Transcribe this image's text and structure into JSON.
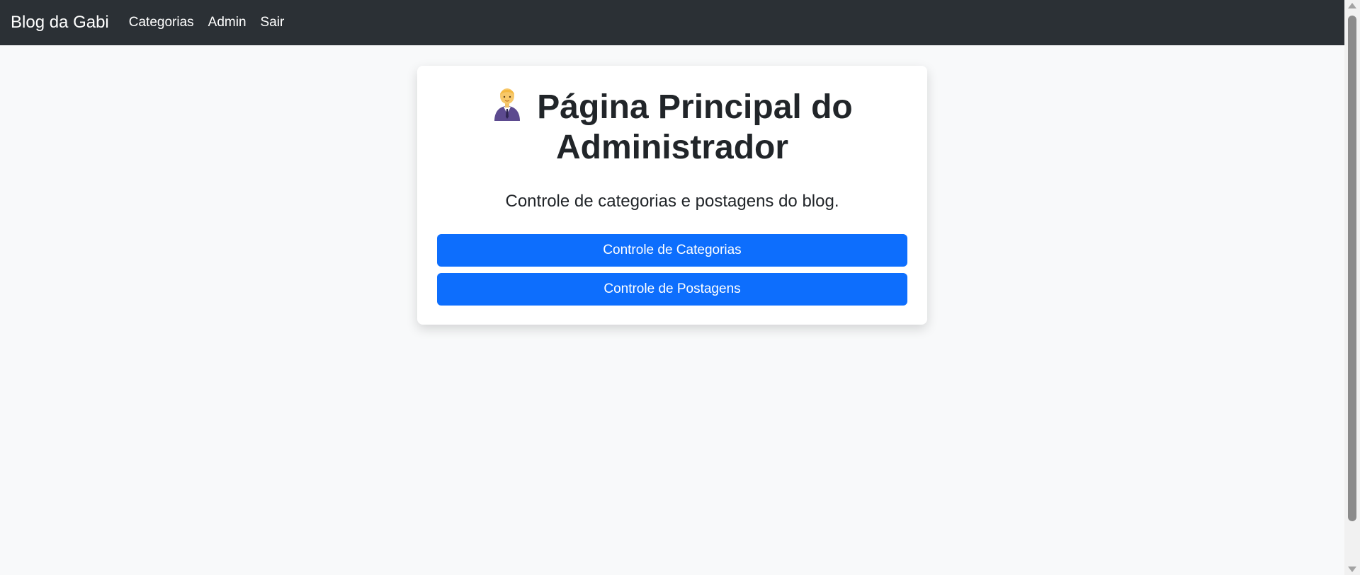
{
  "navbar": {
    "brand": "Blog da Gabi",
    "links": [
      "Categorias",
      "Admin",
      "Sair"
    ]
  },
  "card": {
    "icon": "man-office-worker-icon",
    "title": "Página Principal do Administrador",
    "subtitle": "Controle de categorias e postagens do blog.",
    "buttons": [
      "Controle de Categorias",
      "Controle de Postagens"
    ]
  },
  "colors": {
    "navbar_bg": "#2b3035",
    "page_bg": "#f8f9fa",
    "primary": "#0d6efd"
  }
}
